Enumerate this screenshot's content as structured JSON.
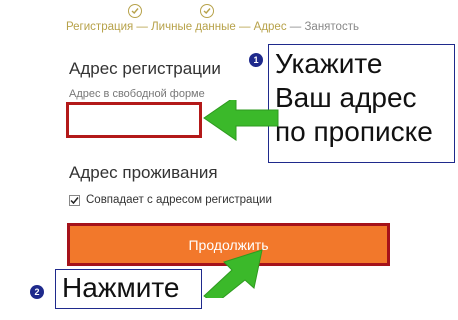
{
  "progress": {
    "step1": "Регистрация",
    "sep1": " — ",
    "step2": "Личные данные",
    "sep2": " — ",
    "step3": "Адрес",
    "sep3": " — ",
    "step4": "Занятость"
  },
  "registration": {
    "title": "Адрес регистрации",
    "field_label": "Адрес в свободной форме",
    "field_value": ""
  },
  "residence": {
    "title": "Адрес проживания",
    "checkbox_label": "Совпадает с адресом регистрации",
    "checkbox_checked": true
  },
  "continue_button": "Продолжить",
  "annotations": {
    "badge1": "1",
    "callout1_lines": [
      "Укажите",
      "Ваш адрес",
      "по прописке"
    ],
    "badge2": "2",
    "callout2": "Нажмите"
  },
  "colors": {
    "accent_gold": "#b7a24a",
    "button_orange": "#f2782b",
    "highlight_red": "#a5121a",
    "annotation_blue": "#1f2a8c",
    "arrow_green": "#3bb92a"
  }
}
